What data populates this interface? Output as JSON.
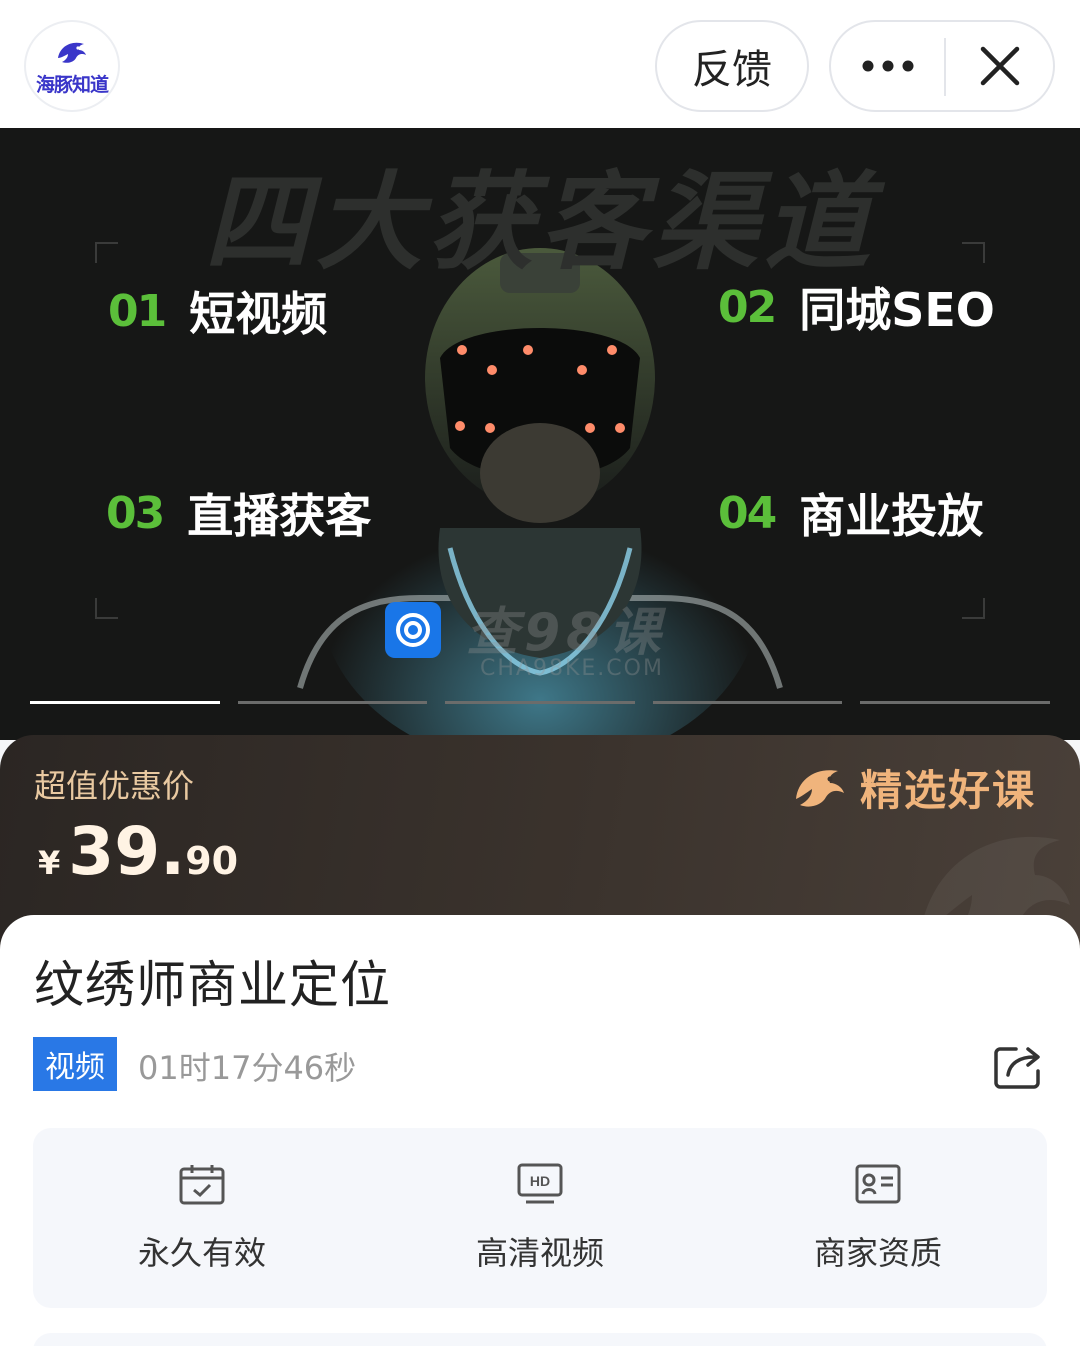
{
  "header": {
    "logo_text": "海豚知道",
    "feedback_label": "反馈",
    "more_icon": "more-dots-icon",
    "close_icon": "close-icon"
  },
  "banner": {
    "title": "四大获客渠道",
    "channels": [
      {
        "num": "01",
        "label": "短视频"
      },
      {
        "num": "02",
        "label": "同城SEO"
      },
      {
        "num": "03",
        "label": "直播获客"
      },
      {
        "num": "04",
        "label": "商业投放"
      }
    ],
    "watermark": "查98课",
    "watermark_sub": "CHA98KE.COM",
    "slide_count": 5,
    "active_slide": 1
  },
  "price": {
    "label": "超值优惠价",
    "currency": "¥",
    "integer": "39.",
    "decimal": "90",
    "tag": "精选好课"
  },
  "course": {
    "title": "纹绣师商业定位",
    "type_badge": "视频",
    "duration": "01时17分46秒",
    "features": [
      {
        "icon": "calendar-check-icon",
        "label": "永久有效"
      },
      {
        "icon": "hd-video-icon",
        "label": "高清视频"
      },
      {
        "icon": "merchant-id-card-icon",
        "label": "商家资质"
      }
    ]
  },
  "colors": {
    "accent_green": "#5bbf3a",
    "price_gold": "#e9c9a1",
    "badge_blue": "#2978e6",
    "tag_orange": "#f0b47c"
  }
}
